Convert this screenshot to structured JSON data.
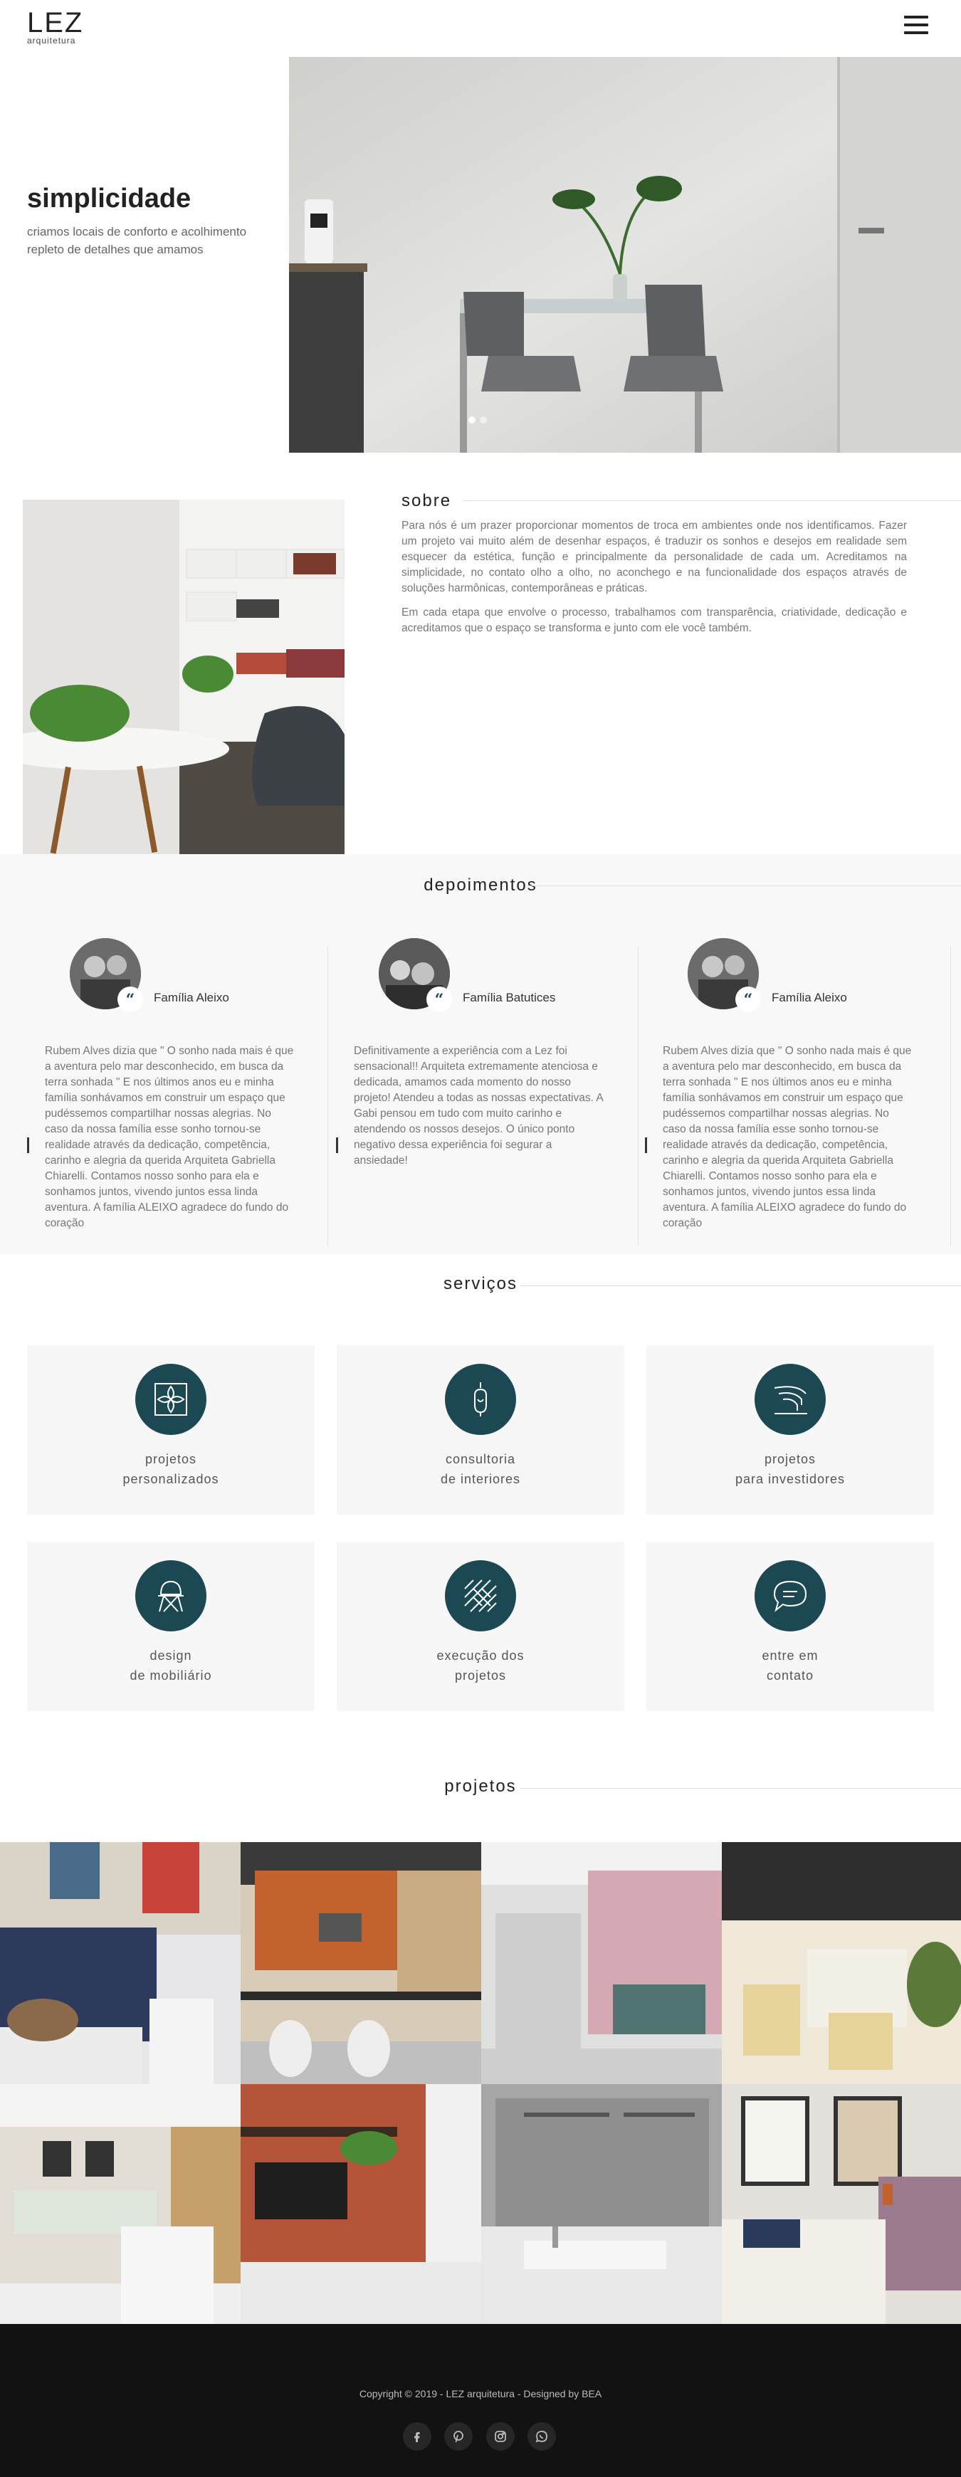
{
  "header": {
    "logo_mark": "LEZ",
    "logo_sub": "arquitetura",
    "menu_icon": "hamburger-icon"
  },
  "hero": {
    "title": "simplicidade",
    "subtitle_line1": "criamos locais de conforto e acolhimento",
    "subtitle_line2": "repleto de detalhes que amamos",
    "slides": 2,
    "active_slide": 1
  },
  "sobre": {
    "title": "sobre",
    "paragraph1": "Para nós é um prazer proporcionar momentos de troca em ambientes onde nos identificamos. Fazer um projeto vai muito além de desenhar espaços, é traduzir os sonhos e desejos em realidade sem esquecer da estética, função e principalmente da personalidade de cada um. Acreditamos na simplicidade, no contato olho a olho, no aconchego e na funcionalidade dos espaços através de soluções harmônicas, contemporâneas e práticas.",
    "paragraph2": "Em cada etapa que envolve o processo, trabalhamos com transparência, criatividade, dedicação e acreditamos que o espaço se transforma e junto com ele você também."
  },
  "depoimentos": {
    "title": "depoimentos",
    "items": [
      {
        "name": "Família Aleixo",
        "text": "Rubem Alves dizia que \" O sonho nada mais é que a aventura pelo mar desconhecido, em busca da terra sonhada \" E nos últimos anos eu e minha família sonhávamos em construir um espaço que pudéssemos compartilhar nossas alegrias. No caso da nossa família esse sonho tornou-se realidade através da dedicação, competência, carinho e alegria da querida Arquiteta Gabriella Chiarelli. Contamos nosso sonho para ela e sonhamos juntos, vivendo juntos essa linda aventura. A família ALEIXO agradece do fundo do coração"
      },
      {
        "name": "Família Batutices",
        "text": "Definitivamente a experiência com a Lez foi sensacional!! Arquiteta extremamente atenciosa e dedicada, amamos cada momento do nosso projeto! Atendeu a todas as nossas expectativas. A Gabi pensou em tudo com muito carinho e atendendo os nossos desejos. O único ponto negativo dessa experiência foi segurar a ansiedade!"
      },
      {
        "name": "Família Aleixo",
        "text": "Rubem Alves dizia que \" O sonho nada mais é que a aventura pelo mar desconhecido, em busca da terra sonhada \" E nos últimos anos eu e minha família sonhávamos em construir um espaço que pudéssemos compartilhar nossas alegrias. No caso da nossa família esse sonho tornou-se realidade através da dedicação, competência, carinho e alegria da querida Arquiteta Gabriella Chiarelli. Contamos nosso sonho para ela e sonhamos juntos, vivendo juntos essa linda aventura. A família ALEIXO agradece do fundo do coração"
      }
    ]
  },
  "servicos": {
    "title": "serviços",
    "items": [
      {
        "label": "projetos\npersonalizados",
        "icon": "pattern-tile-icon"
      },
      {
        "label": "consultoria\nde interiores",
        "icon": "lightbulb-icon"
      },
      {
        "label": "projetos\npara investidores",
        "icon": "staircase-icon"
      },
      {
        "label": "design\nde mobiliário",
        "icon": "chair-icon"
      },
      {
        "label": "execução dos\nprojetos",
        "icon": "herringbone-floor-icon"
      },
      {
        "label": "entre em\ncontato",
        "icon": "chat-bubble-icon"
      }
    ]
  },
  "projetos": {
    "title": "projetos"
  },
  "footer": {
    "copyright": "Copyright © 2019 - LEZ arquitetura - Designed by BEA",
    "socials": [
      "facebook-icon",
      "pinterest-icon",
      "instagram-icon",
      "whatsapp-icon"
    ]
  },
  "colors": {
    "accent": "#1c4853",
    "footer_bg": "#121212",
    "band_bg": "#f8f8f8"
  }
}
